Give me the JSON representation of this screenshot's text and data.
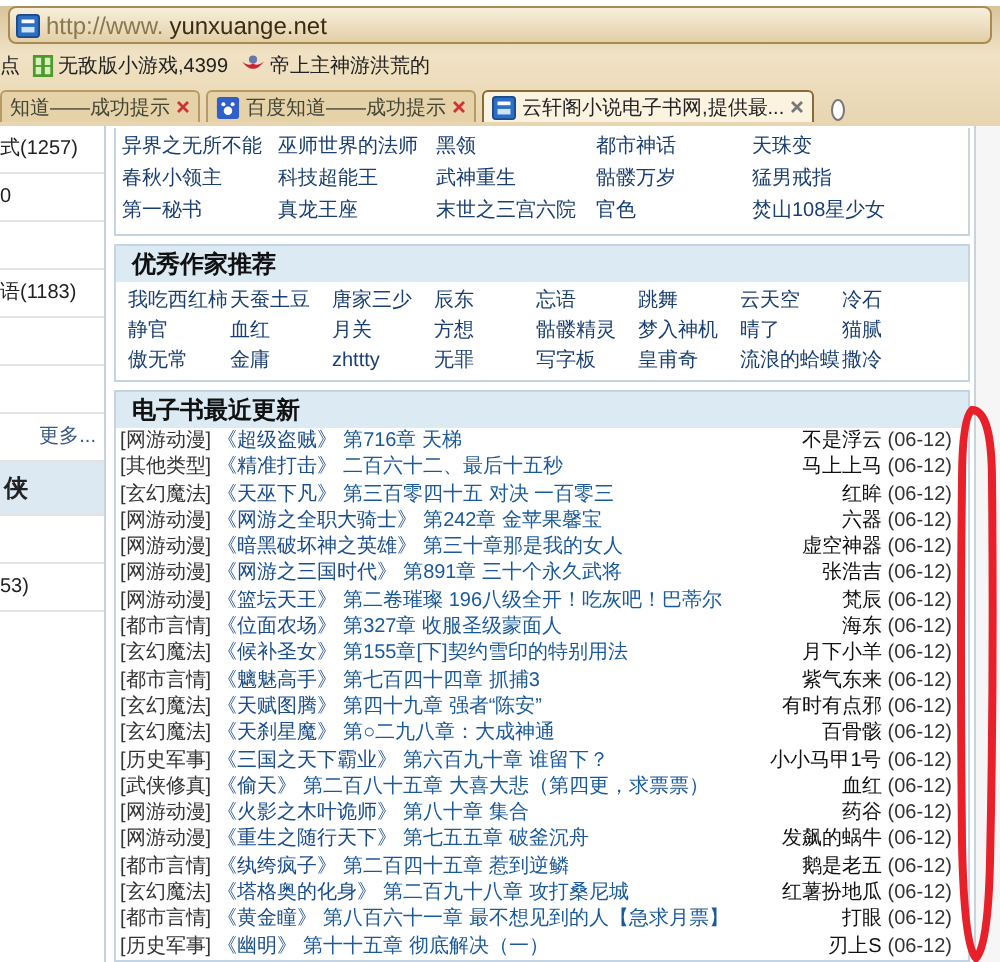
{
  "address_bar": {
    "prefix": "http://www.",
    "domain": "yunxuange.net"
  },
  "bookmarks": [
    {
      "label": "点"
    },
    {
      "label": "无敌版小游戏,4399"
    },
    {
      "label": "帝上主神游洪荒的"
    }
  ],
  "tabs": [
    {
      "label": "知道——成功提示",
      "selected": false
    },
    {
      "label": "百度知道——成功提示",
      "selected": false
    },
    {
      "label": "云轩阁小说电子书网,提供最...",
      "selected": true
    }
  ],
  "sidebar": {
    "items": [
      {
        "label": "式(1257)",
        "kind": "text"
      },
      {
        "label": "0",
        "kind": "text"
      },
      {
        "kind": "blank"
      },
      {
        "label": "语(1183)",
        "kind": "text"
      },
      {
        "kind": "blank"
      },
      {
        "kind": "blank"
      },
      {
        "label": "更多...",
        "kind": "more"
      },
      {
        "label": "侠",
        "kind": "header"
      },
      {
        "kind": "blank"
      },
      {
        "label": "53)",
        "kind": "text"
      }
    ]
  },
  "book_grid": [
    [
      "异界之无所不能",
      "巫师世界的法师",
      "黑领",
      "都市神话",
      "天珠变"
    ],
    [
      "春秋小领主",
      "科技超能王",
      "武神重生",
      "骷髅万岁",
      "猛男戒指"
    ],
    [
      "第一秘书",
      "真龙王座",
      "末世之三宫六院",
      "官色",
      "焚山108星少女"
    ]
  ],
  "authors": {
    "title": "优秀作家推荐",
    "rows": [
      [
        "我吃西红柿",
        "天蚕土豆",
        "唐家三少",
        "辰东",
        "忘语",
        "跳舞",
        "云天空",
        "冷石"
      ],
      [
        "静官",
        "血红",
        "月关",
        "方想",
        "骷髅精灵",
        "梦入神机",
        "晴了",
        "猫腻"
      ],
      [
        "傲无常",
        "金庸",
        "zhttty",
        "无罪",
        "写字板",
        "皇甫奇",
        "流浪的蛤蟆",
        "撒冷"
      ]
    ]
  },
  "updates": {
    "title": "电子书最近更新",
    "rows": [
      {
        "category": "[网游动漫]",
        "book": "《超级盗贼》",
        "chapter": "第716章 天梯",
        "author": "不是浮云",
        "date": "(06-12)"
      },
      {
        "category": "[其他类型]",
        "book": "《精准打击》",
        "chapter": "二百六十二、最后十五秒",
        "author": "马上上马",
        "date": "(06-12)"
      },
      {
        "category": "[玄幻魔法]",
        "book": "《天巫下凡》",
        "chapter": "第三百零四十五 对决 一百零三",
        "author": "红眸",
        "date": "(06-12)"
      },
      {
        "category": "[网游动漫]",
        "book": "《网游之全职大骑士》",
        "chapter": "第242章 金苹果馨宝",
        "author": "六器",
        "date": "(06-12)"
      },
      {
        "category": "[网游动漫]",
        "book": "《暗黑破坏神之英雄》",
        "chapter": "第三十章那是我的女人",
        "author": "虚空神器",
        "date": "(06-12)"
      },
      {
        "category": "[网游动漫]",
        "book": "《网游之三国时代》",
        "chapter": "第891章 三十个永久武将",
        "author": "张浩吉",
        "date": "(06-12)"
      },
      {
        "category": "[网游动漫]",
        "book": "《篮坛天王》",
        "chapter": "第二卷璀璨 196八级全开！吃灰吧！巴蒂尔",
        "author": "梵辰",
        "date": "(06-12)"
      },
      {
        "category": "[都市言情]",
        "book": "《位面农场》",
        "chapter": "第327章 收服圣级蒙面人",
        "author": "海东",
        "date": "(06-12)"
      },
      {
        "category": "[玄幻魔法]",
        "book": "《候补圣女》",
        "chapter": "第155章[下]契约雪印的特别用法",
        "author": "月下小羊",
        "date": "(06-12)"
      },
      {
        "category": "[都市言情]",
        "book": "《魑魅高手》",
        "chapter": "第七百四十四章 抓捕3",
        "author": "紫气东来",
        "date": "(06-12)"
      },
      {
        "category": "[玄幻魔法]",
        "book": "《天赋图腾》",
        "chapter": "第四十九章 强者“陈安”",
        "author": "有时有点邪",
        "date": "(06-12)"
      },
      {
        "category": "[玄幻魔法]",
        "book": "《天刹星魔》",
        "chapter": "第○二九八章：大成神通",
        "author": "百骨骸",
        "date": "(06-12)"
      },
      {
        "category": "[历史军事]",
        "book": "《三国之天下霸业》",
        "chapter": "第六百九十章 谁留下？",
        "author": "小小马甲1号",
        "date": "(06-12)"
      },
      {
        "category": "[武侠修真]",
        "book": "《偷天》",
        "chapter": "第二百八十五章 大喜大悲（第四更，求票票）",
        "author": "血红",
        "date": "(06-12)"
      },
      {
        "category": "[网游动漫]",
        "book": "《火影之木叶诡师》",
        "chapter": "第八十章 集合",
        "author": "药谷",
        "date": "(06-12)"
      },
      {
        "category": "[网游动漫]",
        "book": "《重生之随行天下》",
        "chapter": "第七五五章 破釜沉舟",
        "author": "发飙的蜗牛",
        "date": "(06-12)"
      },
      {
        "category": "[都市言情]",
        "book": "《纨绔疯子》",
        "chapter": "第二百四十五章 惹到逆鳞",
        "author": "鹅是老五",
        "date": "(06-12)"
      },
      {
        "category": "[玄幻魔法]",
        "book": "《塔格奥的化身》",
        "chapter": "第二百九十八章 攻打桑尼城",
        "author": "红薯扮地瓜",
        "date": "(06-12)"
      },
      {
        "category": "[都市言情]",
        "book": "《黄金瞳》",
        "chapter": "第八百六十一章 最不想见到的人【急求月票】",
        "author": "打眼",
        "date": "(06-12)"
      },
      {
        "category": "[历史军事]",
        "book": "《幽明》",
        "chapter": "第十十五章 彻底解决（一）",
        "author": "刃上S",
        "date": "(06-12)"
      }
    ]
  }
}
